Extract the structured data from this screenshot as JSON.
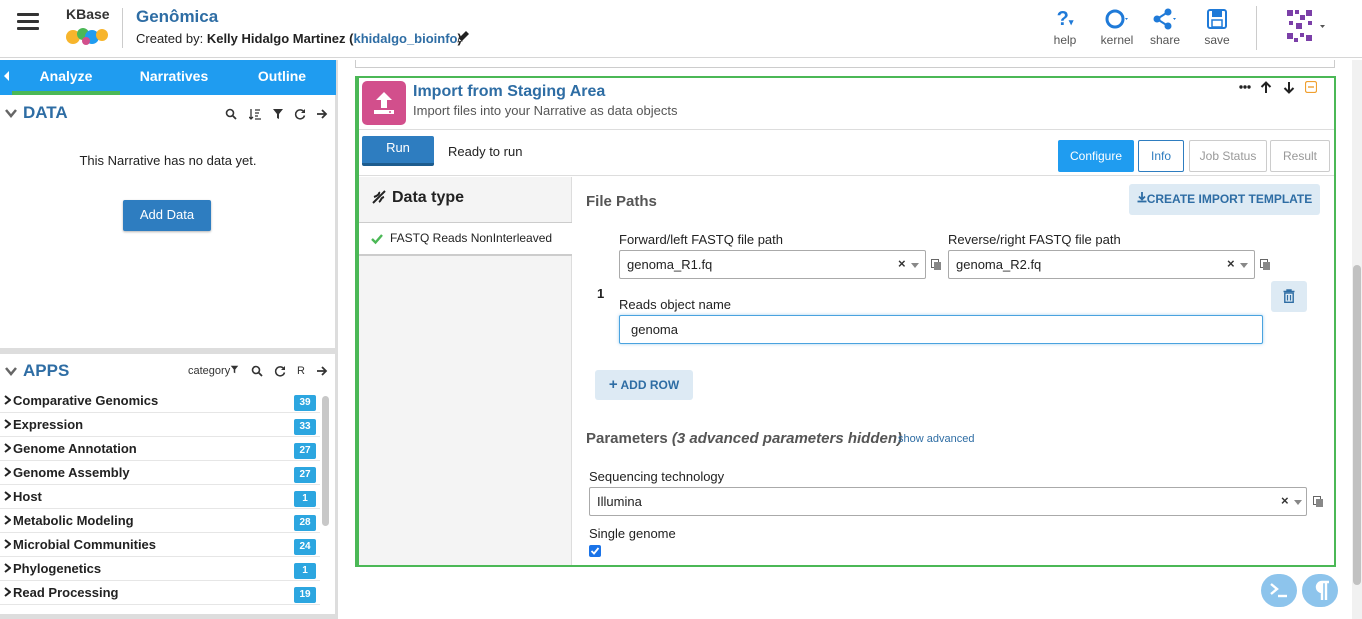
{
  "header": {
    "logo_text": "KBase",
    "narrative_title": "Genômica",
    "created_by_prefix": "Created by:",
    "author_name": "Kelly Hidalgo Martinez",
    "author_username": "khidalgo_bioinfo",
    "buttons": {
      "help": "help",
      "kernel": "kernel",
      "share": "share",
      "save": "save"
    }
  },
  "sidebar": {
    "tabs": [
      "Analyze",
      "Narratives",
      "Outline"
    ],
    "active_tab": "Analyze",
    "data": {
      "title": "DATA",
      "empty_message": "This Narrative has no data yet.",
      "add_data_label": "Add Data"
    },
    "apps": {
      "title": "APPS",
      "category_label": "category",
      "r_label": "R",
      "items": [
        {
          "name": "Comparative Genomics",
          "count": "39"
        },
        {
          "name": "Expression",
          "count": "33"
        },
        {
          "name": "Genome Annotation",
          "count": "27"
        },
        {
          "name": "Genome Assembly",
          "count": "27"
        },
        {
          "name": "Host",
          "count": "1"
        },
        {
          "name": "Metabolic Modeling",
          "count": "28"
        },
        {
          "name": "Microbial Communities",
          "count": "24"
        },
        {
          "name": "Phylogenetics",
          "count": "1"
        },
        {
          "name": "Read Processing",
          "count": "19"
        }
      ]
    }
  },
  "cell": {
    "title": "Import from Staging Area",
    "subtitle": "Import files into your Narrative as data objects",
    "run_label": "Run",
    "status": "Ready to run",
    "tabs": {
      "configure": "Configure",
      "info": "Info",
      "job_status": "Job Status",
      "result": "Result"
    },
    "data_type_title": "Data type",
    "data_type_item": "FASTQ Reads NonInterleaved",
    "file_paths_title": "File Paths",
    "create_template_label": "CREATE IMPORT TEMPLATE",
    "forward_label": "Forward/left FASTQ file path",
    "forward_value": "genoma_R1.fq",
    "reverse_label": "Reverse/right FASTQ file path",
    "reverse_value": "genoma_R2.fq",
    "row_number": "1",
    "reads_name_label": "Reads object name",
    "reads_name_value": "genoma",
    "add_row_label": "ADD ROW",
    "params_title": "Parameters",
    "params_hidden": "(3 advanced parameters hidden)",
    "show_advanced": "show advanced",
    "seq_tech_label": "Sequencing technology",
    "seq_tech_value": "Illumina",
    "single_genome_label": "Single genome",
    "single_genome_checked": true
  },
  "colors": {
    "brand_blue": "#1f9cf0",
    "title_blue": "#2e6da4",
    "cell_border_green": "#4bb856",
    "app_icon_pink": "#d24f8c"
  }
}
